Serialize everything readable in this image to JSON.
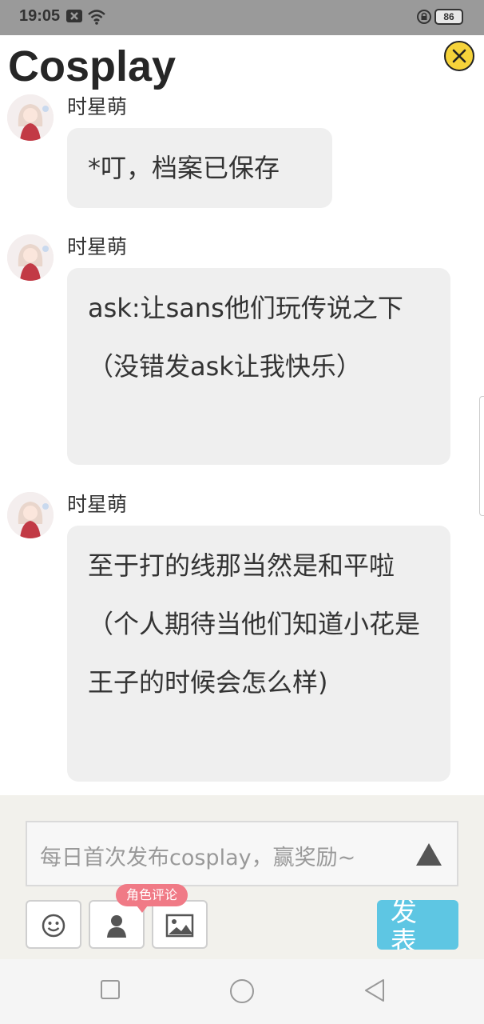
{
  "status_bar": {
    "time": "19:05",
    "battery": "86",
    "icons": [
      "notification-x-icon",
      "wifi-icon",
      "lock-icon",
      "battery-icon"
    ]
  },
  "header": {
    "title": "Cosplay",
    "close_icon": "close-icon",
    "accent": "#f6d33a"
  },
  "messages": [
    {
      "sender": "时星萌",
      "text": "*叮，档案已保存"
    },
    {
      "sender": "时星萌",
      "text": "ask:让sans他们玩传说之下（没错发ask让我快乐）"
    },
    {
      "sender": "时星萌",
      "text": "至于打的线那当然是和平啦（个人期待当他们知道小花是王子的时候会怎么样)"
    }
  ],
  "composer": {
    "placeholder": "每日首次发布cosplay，赢奖励~",
    "tools": [
      "emoji-icon",
      "character-icon",
      "image-icon"
    ],
    "badge": "角色评论",
    "send_label": "发表",
    "send_color": "#5ec6e3"
  },
  "nav_bar": {
    "buttons": [
      "recent-apps-icon",
      "home-icon",
      "back-icon"
    ]
  }
}
